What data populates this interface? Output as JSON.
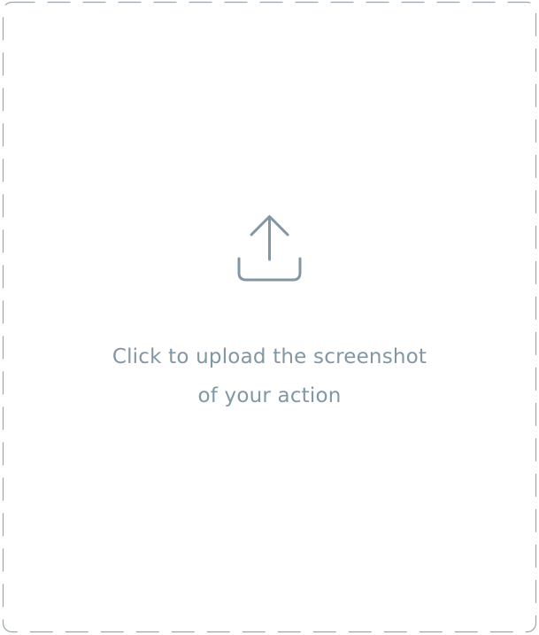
{
  "upload": {
    "line1": "Click to upload the screenshot",
    "line2": "of your action",
    "icon": "upload-icon"
  },
  "colors": {
    "border": "#9aa6ad",
    "icon": "#8297a3",
    "text": "#8297a3"
  }
}
